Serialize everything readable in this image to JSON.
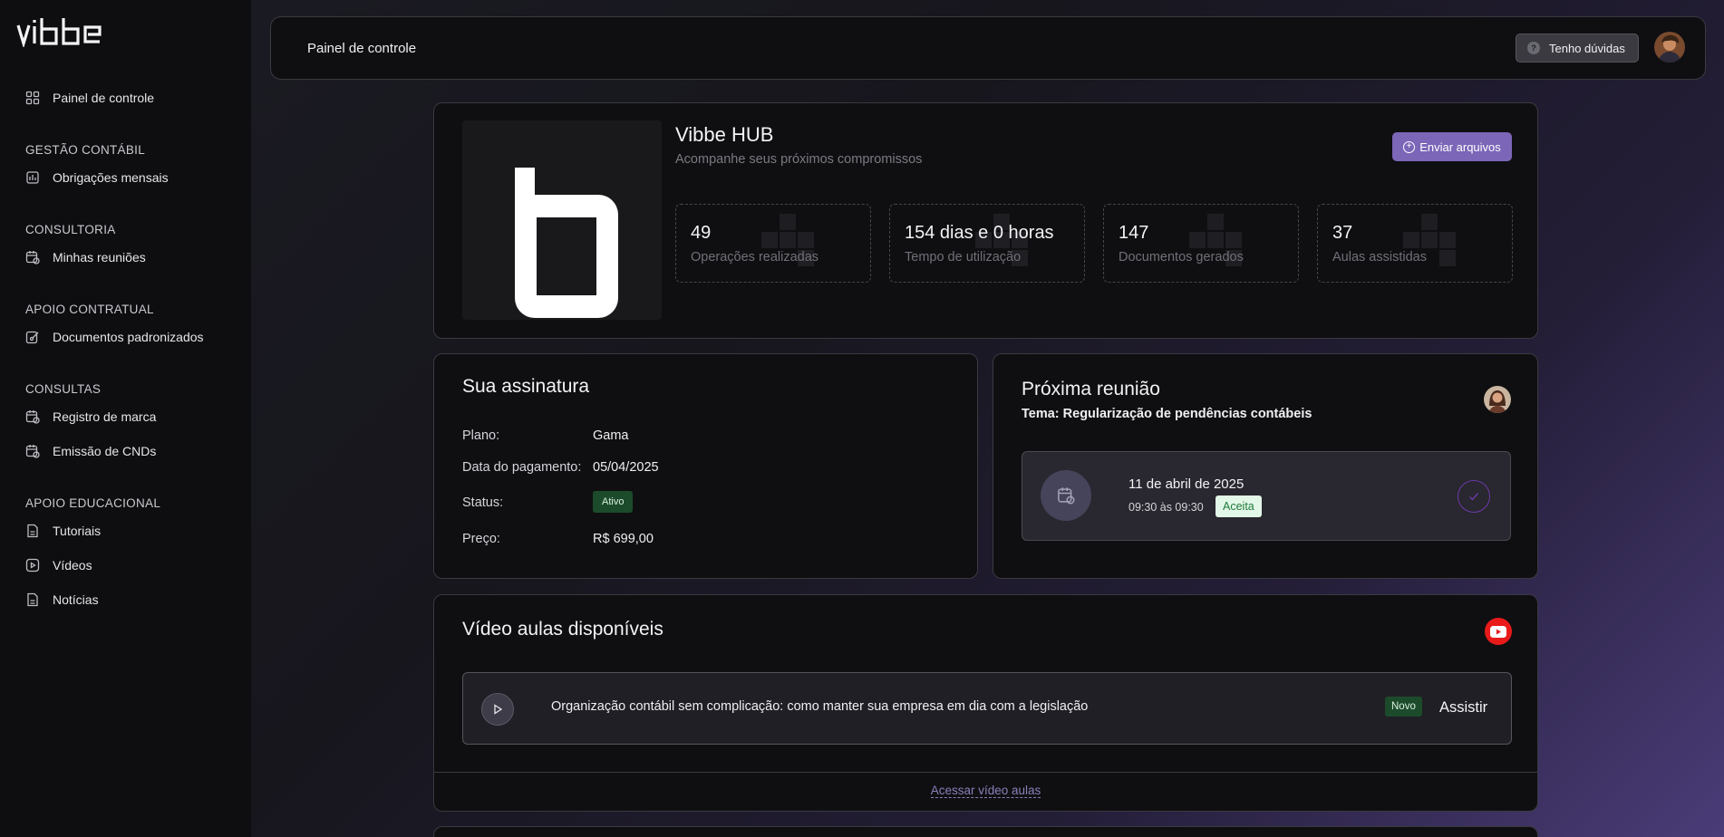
{
  "app": {
    "brand": "vibbe"
  },
  "sidebar": {
    "dashboard": {
      "label": "Painel de controle",
      "icon": "grid-icon"
    },
    "sections": [
      {
        "title": "GESTÃO CONTÁBIL",
        "items": [
          {
            "label": "Obrigações mensais",
            "icon": "building-icon"
          }
        ]
      },
      {
        "title": "CONSULTORIA",
        "items": [
          {
            "label": "Minhas reuniões",
            "icon": "calendar-icon"
          }
        ]
      },
      {
        "title": "APOIO CONTRATUAL",
        "items": [
          {
            "label": "Documentos padronizados",
            "icon": "edit-document-icon"
          }
        ]
      },
      {
        "title": "CONSULTAS",
        "items": [
          {
            "label": "Registro de marca",
            "icon": "calendar-icon"
          },
          {
            "label": "Emissão de CNDs",
            "icon": "calendar-icon"
          }
        ]
      },
      {
        "title": "APOIO EDUCACIONAL",
        "items": [
          {
            "label": "Tutoriais",
            "icon": "document-icon"
          },
          {
            "label": "Vídeos",
            "icon": "video-icon"
          },
          {
            "label": "Notícias",
            "icon": "document-icon"
          }
        ]
      }
    ]
  },
  "topbar": {
    "title": "Painel de controle",
    "help_label": "Tenho dúvidas",
    "help_glyph": "?"
  },
  "hero": {
    "title": "Vibbe HUB",
    "subtitle": "Acompanhe seus próximos compromissos",
    "send_label": "Enviar arquivos",
    "send_glyph": "+",
    "stats": [
      {
        "value": "49",
        "label": "Operações realizadas"
      },
      {
        "value": "154 dias e 0 horas",
        "label": "Tempo de utilização"
      },
      {
        "value": "147",
        "label": "Documentos gerados"
      },
      {
        "value": "37",
        "label": "Aulas assistidas"
      }
    ]
  },
  "subscription": {
    "title": "Sua assinatura",
    "plan_label": "Plano:",
    "plan_value": "Gama",
    "payment_label": "Data do pagamento:",
    "payment_value": "05/04/2025",
    "status_label": "Status:",
    "status_value": "Ativo",
    "price_label": "Preço:",
    "price_value": "R$ 699,00"
  },
  "meeting": {
    "title": "Próxima reunião",
    "topic": "Tema: Regularização de pendências contábeis",
    "date": "11 de abril de 2025",
    "time": "09:30 às 09:30",
    "status": "Aceita"
  },
  "videos": {
    "title": "Vídeo aulas disponíveis",
    "items": [
      {
        "title": "Organização contábil sem complicação: como manter sua empresa em dia com a legislação",
        "badge": "Novo",
        "action": "Assistir"
      }
    ],
    "access_label": "Acessar vídeo aulas"
  },
  "colors": {
    "accent": "#7b66b8",
    "success_bg": "#1c4b2b",
    "youtube": "#e81a1a"
  }
}
